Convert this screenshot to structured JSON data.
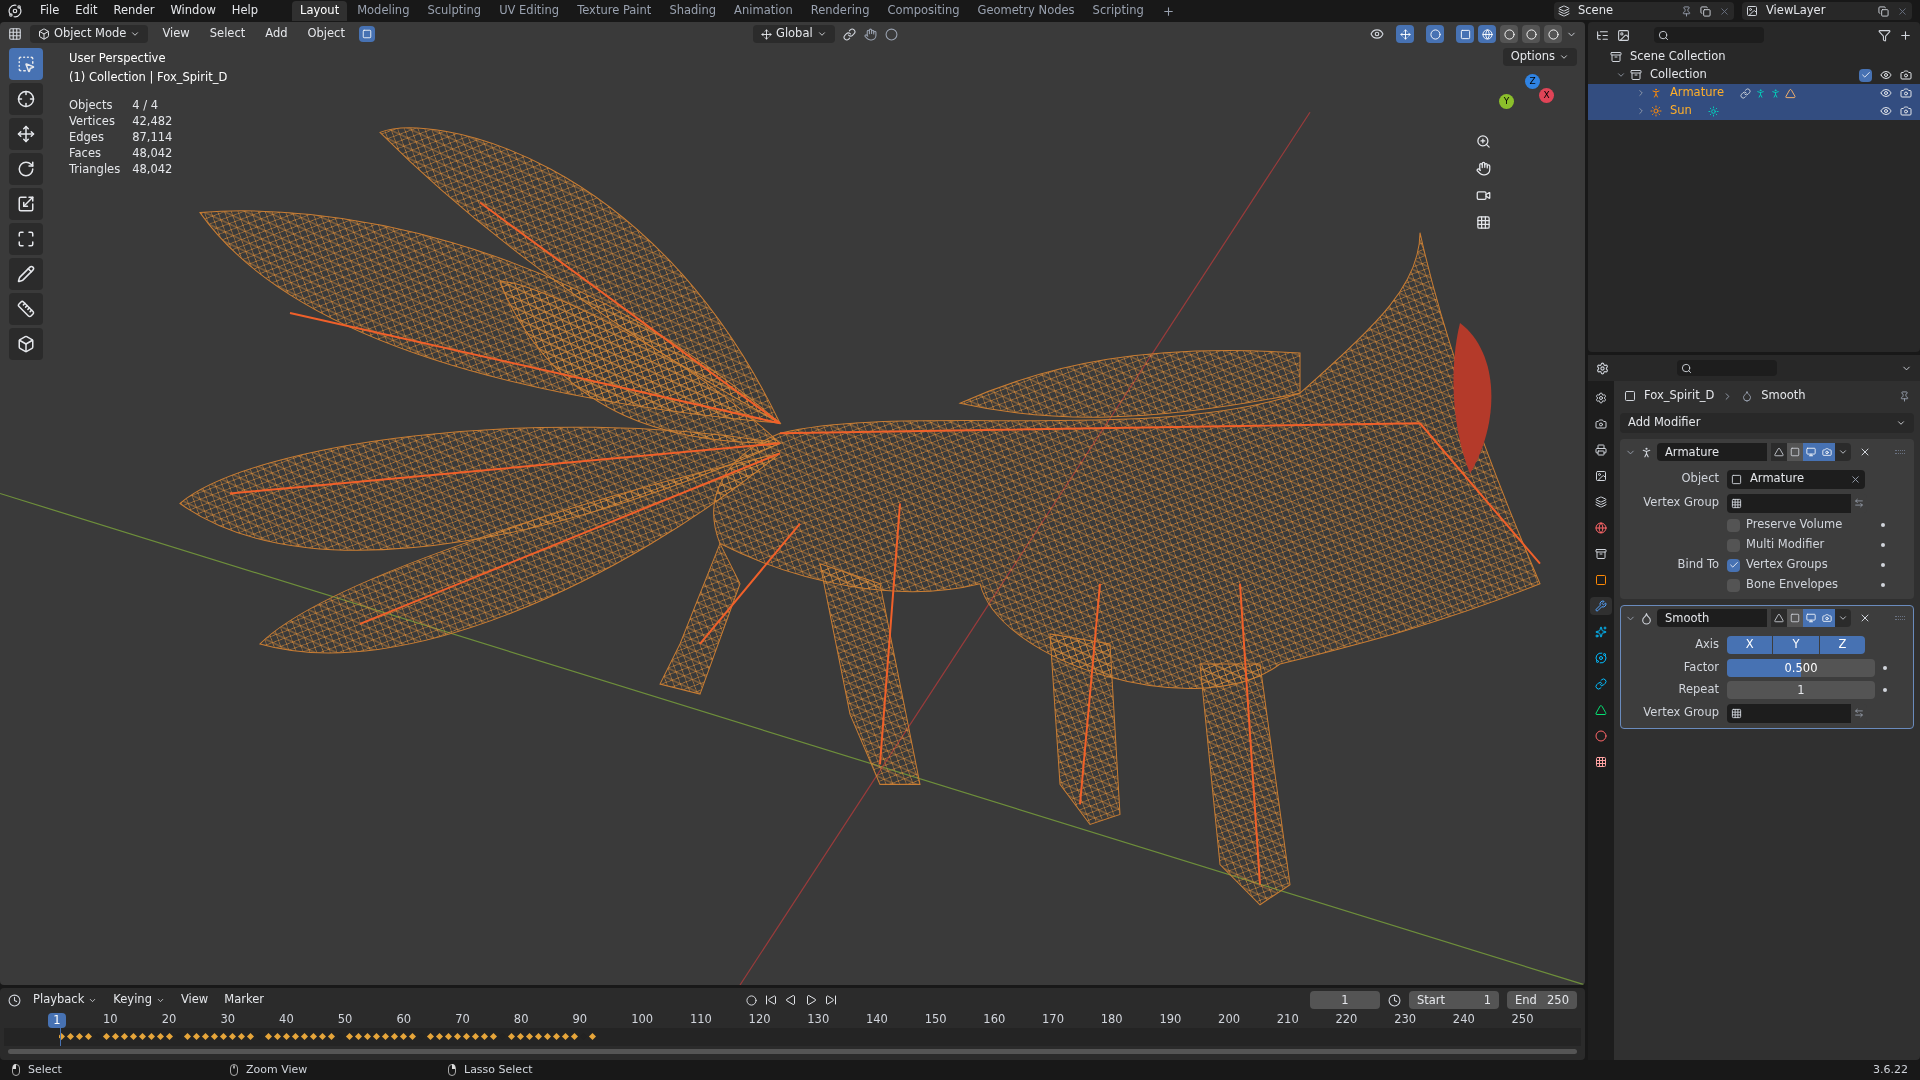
{
  "menu": [
    "File",
    "Edit",
    "Render",
    "Window",
    "Help"
  ],
  "workspaces": [
    {
      "label": "Layout",
      "selected": true
    },
    {
      "label": "Modeling",
      "selected": false
    },
    {
      "label": "Sculpting",
      "selected": false
    },
    {
      "label": "UV Editing",
      "selected": false
    },
    {
      "label": "Texture Paint",
      "selected": false
    },
    {
      "label": "Shading",
      "selected": false
    },
    {
      "label": "Animation",
      "selected": false
    },
    {
      "label": "Rendering",
      "selected": false
    },
    {
      "label": "Compositing",
      "selected": false
    },
    {
      "label": "Geometry Nodes",
      "selected": false
    },
    {
      "label": "Scripting",
      "selected": false
    }
  ],
  "scene": "Scene",
  "view_layer": "ViewLayer",
  "viewport": {
    "mode": "Object Mode",
    "menus": [
      "View",
      "Select",
      "Add",
      "Object"
    ],
    "orientation": "Global",
    "options": "Options",
    "shading": [
      {
        "kind": "wireframe",
        "selected": true
      },
      {
        "kind": "solid",
        "selected": false
      },
      {
        "kind": "material",
        "selected": false
      },
      {
        "kind": "rendered",
        "selected": false
      }
    ],
    "title": "User Perspective",
    "subtitle": "(1) Collection | Fox_Spirit_D",
    "stats": [
      {
        "label": "Objects",
        "value": "4 / 4"
      },
      {
        "label": "Vertices",
        "value": "42,482"
      },
      {
        "label": "Edges",
        "value": "87,114"
      },
      {
        "label": "Faces",
        "value": "48,042"
      },
      {
        "label": "Triangles",
        "value": "48,042"
      }
    ],
    "gizmo": [
      "Z",
      "Y",
      "X"
    ],
    "tools": [
      {
        "kind": "select",
        "selected": true
      },
      {
        "kind": "cursor",
        "selected": false
      },
      {
        "kind": "move",
        "selected": false
      },
      {
        "kind": "rotate",
        "selected": false
      },
      {
        "kind": "scale",
        "selected": false
      },
      {
        "kind": "transform",
        "selected": false
      },
      {
        "kind": "annotate",
        "selected": false
      },
      {
        "kind": "measure",
        "selected": false
      },
      {
        "kind": "add-cube",
        "selected": false
      }
    ]
  },
  "outliner": {
    "items": [
      {
        "label": "Scene Collection",
        "kind": "scene",
        "selected": false,
        "children": [
          {
            "label": "Collection",
            "kind": "collection",
            "selected": false,
            "checked": true,
            "children": [
              {
                "label": "Armature",
                "kind": "armature",
                "selected": true
              },
              {
                "label": "Sun",
                "kind": "light",
                "selected": true
              }
            ]
          }
        ]
      }
    ]
  },
  "properties": {
    "object": "Fox_Spirit_D",
    "modifier": "Smooth",
    "add_modifier": "Add Modifier",
    "tabs": [
      {
        "kind": "tool",
        "selected": false
      },
      {
        "kind": "render",
        "selected": false
      },
      {
        "kind": "output",
        "selected": false
      },
      {
        "kind": "view-layer",
        "selected": false
      },
      {
        "kind": "scene",
        "selected": false
      },
      {
        "kind": "world",
        "selected": false
      },
      {
        "kind": "collection",
        "selected": false
      },
      {
        "kind": "object",
        "selected": false
      },
      {
        "kind": "modifiers",
        "selected": true
      },
      {
        "kind": "particles",
        "selected": false
      },
      {
        "kind": "physics",
        "selected": false
      },
      {
        "kind": "constraints",
        "selected": false
      },
      {
        "kind": "data",
        "selected": false
      },
      {
        "kind": "material",
        "selected": false
      },
      {
        "kind": "texture",
        "selected": false
      }
    ],
    "modifiers": [
      {
        "kind": "armature",
        "name": "Armature",
        "active": false,
        "rows": [
          {
            "kind": "object",
            "label": "Object",
            "value": "Armature"
          },
          {
            "kind": "vertex-group",
            "label": "Vertex Group"
          },
          {
            "kind": "checkbox",
            "text": "Preserve Volume",
            "checked": false
          },
          {
            "kind": "checkbox",
            "text": "Multi Modifier",
            "checked": false
          },
          {
            "kind": "checkbox",
            "label": "Bind To",
            "text": "Vertex Groups",
            "checked": true
          },
          {
            "kind": "checkbox",
            "text": "Bone Envelopes",
            "checked": false
          }
        ]
      },
      {
        "kind": "smooth",
        "name": "Smooth",
        "active": true,
        "rows": [
          {
            "kind": "axis",
            "label": "Axis",
            "axes": [
              {
                "label": "X",
                "selected": true
              },
              {
                "label": "Y",
                "selected": true
              },
              {
                "label": "Z",
                "selected": true
              }
            ]
          },
          {
            "kind": "slider",
            "label": "Factor",
            "value": "0.500",
            "level": 0.5
          },
          {
            "kind": "number",
            "label": "Repeat",
            "value": "1"
          },
          {
            "kind": "vertex-group",
            "label": "Vertex Group"
          }
        ]
      }
    ]
  },
  "timeline": {
    "menus": [
      "Playback",
      "Keying",
      "View",
      "Marker"
    ],
    "frame": "1",
    "start_label": "Start",
    "start": "1",
    "end_label": "End",
    "end": "250",
    "indicator": "1",
    "ticks": [
      "10",
      "20",
      "30",
      "40",
      "50",
      "60",
      "70",
      "80",
      "90",
      "100",
      "110",
      "120",
      "130",
      "140",
      "150",
      "160",
      "170",
      "180",
      "190",
      "200",
      "210",
      "220",
      "230",
      "240",
      "250"
    ]
  },
  "status": [
    {
      "kind": "left",
      "label": "Select"
    },
    {
      "kind": "middle",
      "label": "Zoom View"
    },
    {
      "kind": "right",
      "label": "Lasso Select"
    }
  ],
  "version": "3.6.22"
}
